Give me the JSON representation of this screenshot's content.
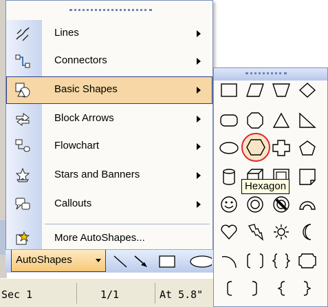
{
  "menu": {
    "items": [
      {
        "label": "Lines",
        "icon": "lines-icon",
        "submenu": true
      },
      {
        "label": "Connectors",
        "icon": "connectors-icon",
        "submenu": true
      },
      {
        "label": "Basic Shapes",
        "icon": "basic-shapes-icon",
        "submenu": true,
        "highlighted": true
      },
      {
        "label": "Block Arrows",
        "icon": "block-arrows-icon",
        "submenu": true
      },
      {
        "label": "Flowchart",
        "icon": "flowchart-icon",
        "submenu": true
      },
      {
        "label": "Stars and Banners",
        "icon": "stars-and-banners-icon",
        "submenu": true
      },
      {
        "label": "Callouts",
        "icon": "callouts-icon",
        "submenu": true
      },
      {
        "label": "More AutoShapes...",
        "icon": "more-autoshapes-icon",
        "submenu": false
      }
    ]
  },
  "toolbar": {
    "autoshapes_label": "AutoShapes",
    "tools": [
      "line-tool-icon",
      "arrow-tool-icon",
      "rectangle-tool-icon",
      "oval-tool-icon"
    ]
  },
  "statusbar": {
    "section": "Sec 1",
    "page": "1/1",
    "position": "At 5.8\""
  },
  "submenu": {
    "title": "Basic Shapes",
    "selected": "Hexagon",
    "tooltip": "Hexagon",
    "shapes": [
      "rectangle",
      "parallelogram",
      "trapezoid",
      "diamond",
      "rounded-rectangle",
      "octagon",
      "isosceles-triangle",
      "right-triangle",
      "oval",
      "hexagon",
      "cross",
      "pentagon",
      "can",
      "cube",
      "bevel",
      "folded-corner",
      "smiley-face",
      "donut",
      "no-symbol",
      "block-arc",
      "heart",
      "lightning-bolt",
      "sun",
      "moon",
      "arc",
      "double-bracket",
      "double-brace",
      "plaque",
      "left-bracket",
      "right-bracket",
      "left-brace",
      "right-brace"
    ]
  },
  "colors": {
    "highlight": "#f6d7a5",
    "highlight_border": "#2c3d8a",
    "annotation_circle": "#e0262e",
    "menu_background": "#fbfaf6"
  }
}
